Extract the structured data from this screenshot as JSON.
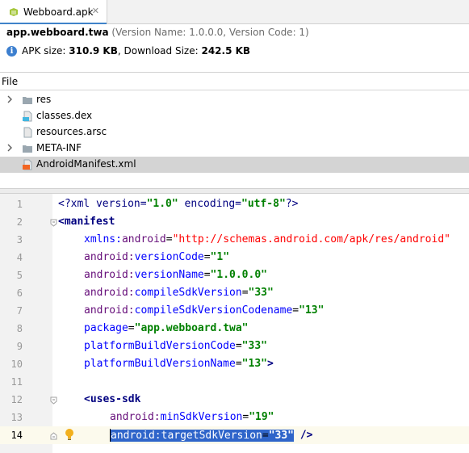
{
  "tab": {
    "label": "Webboard.apk",
    "close": "✕"
  },
  "summary": {
    "app_id": "app.webboard.twa",
    "meta": "(Version Name: 1.0.0.0, Version Code: 1)",
    "apk_size_label": "APK size:",
    "apk_size_value": "310.9 KB",
    "download_size_label": ", Download Size:",
    "download_size_value": "242.5 KB"
  },
  "file_table": {
    "header": "File",
    "items": [
      {
        "label": "res",
        "expandable": true,
        "icon": "folder-icon"
      },
      {
        "label": "classes.dex",
        "expandable": false,
        "icon": "dex-file-icon"
      },
      {
        "label": "resources.arsc",
        "expandable": false,
        "icon": "arsc-file-icon"
      },
      {
        "label": "META-INF",
        "expandable": true,
        "icon": "folder-icon"
      },
      {
        "label": "AndroidManifest.xml",
        "expandable": false,
        "icon": "xml-file-icon",
        "selected": true
      }
    ]
  },
  "editor": {
    "lines": [
      {
        "n": "1"
      },
      {
        "n": "2"
      },
      {
        "n": "3"
      },
      {
        "n": "4"
      },
      {
        "n": "5"
      },
      {
        "n": "6"
      },
      {
        "n": "7"
      },
      {
        "n": "8"
      },
      {
        "n": "9"
      },
      {
        "n": "10"
      },
      {
        "n": "11"
      },
      {
        "n": "12"
      },
      {
        "n": "13"
      },
      {
        "n": "14"
      }
    ],
    "text": {
      "l1_a": "<?xml version=",
      "l1_b": "\"1.0\"",
      "l1_c": " encoding=",
      "l1_d": "\"utf-8\"",
      "l1_e": "?>",
      "l2_a": "<",
      "l2_b": "manifest",
      "l3_ns": "xmlns:",
      "l3_attr": "android",
      "l3_eq": "=",
      "l3_val": "\"http://schemas.android.com/apk/res/android\"",
      "l4_ns": "android:",
      "l4_attr": "versionCode",
      "l4_val": "\"1\"",
      "l5_ns": "android:",
      "l5_attr": "versionName",
      "l5_val": "\"1.0.0.0\"",
      "l6_ns": "android:",
      "l6_attr": "compileSdkVersion",
      "l6_val": "\"33\"",
      "l7_ns": "android:",
      "l7_attr": "compileSdkVersionCodename",
      "l7_val": "\"13\"",
      "l8_attr": "package",
      "l8_val": "\"app.webboard.twa\"",
      "l9_attr": "platformBuildVersionCode",
      "l9_val": "\"33\"",
      "l10_attr": "platformBuildVersionName",
      "l10_val": "\"13\"",
      "l10_end": ">",
      "l12_a": "<",
      "l12_b": "uses-sdk",
      "l13_ns": "android:",
      "l13_attr": "minSdkVersion",
      "l13_val": "\"19\"",
      "l14_ns": "android:",
      "l14_attr": "targetSdkVersion",
      "l14_val": "\"33\"",
      "l14_end": " />",
      "eq": "="
    }
  },
  "colors": {
    "selection": "#2f65ca",
    "string": "#008000",
    "tag": "#000080",
    "attribute": "#0000ff",
    "namespace": "#660e7a",
    "url": "#ff0000",
    "tab_accent": "#4083c9"
  }
}
